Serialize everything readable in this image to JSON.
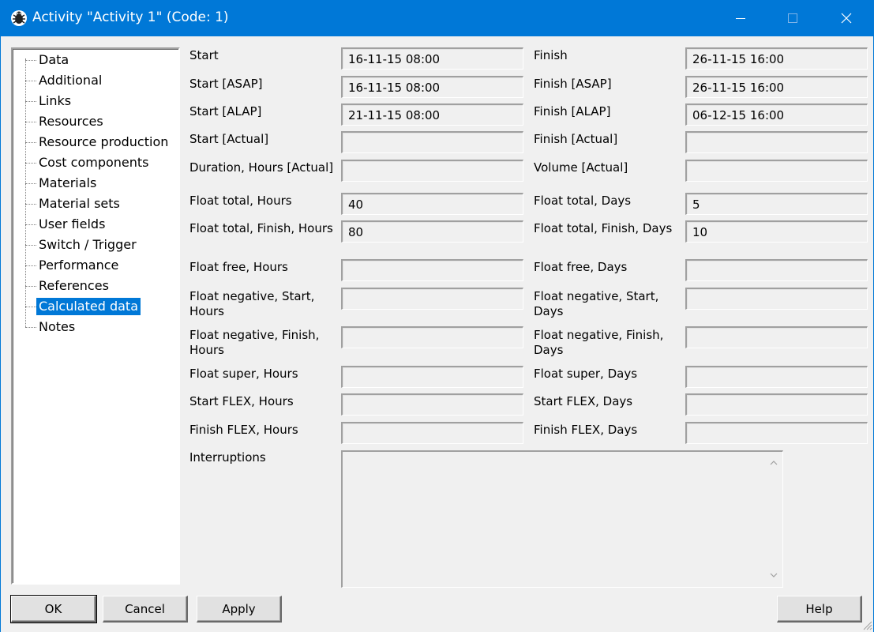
{
  "window": {
    "title": "Activity \"Activity 1\" (Code: 1)",
    "icon": "bug-app-icon",
    "title_bar_color": "#0078d7"
  },
  "tree": {
    "items": [
      {
        "label": "Data",
        "selected": false
      },
      {
        "label": "Additional",
        "selected": false
      },
      {
        "label": "Links",
        "selected": false
      },
      {
        "label": "Resources",
        "selected": false
      },
      {
        "label": "Resource production",
        "selected": false
      },
      {
        "label": "Cost components",
        "selected": false
      },
      {
        "label": "Materials",
        "selected": false
      },
      {
        "label": "Material sets",
        "selected": false
      },
      {
        "label": "User fields",
        "selected": false
      },
      {
        "label": "Switch / Trigger",
        "selected": false
      },
      {
        "label": "Performance",
        "selected": false
      },
      {
        "label": "References",
        "selected": false
      },
      {
        "label": "Calculated data",
        "selected": true
      },
      {
        "label": "Notes",
        "selected": false
      }
    ]
  },
  "form": {
    "rows": [
      {
        "left_label": "Start",
        "left_value": "16-11-15  08:00",
        "right_label": "Finish",
        "right_value": "26-11-15  16:00"
      },
      {
        "left_label": "Start [ASAP]",
        "left_value": "16-11-15  08:00",
        "right_label": "Finish [ASAP]",
        "right_value": "26-11-15  16:00"
      },
      {
        "left_label": "Start [ALAP]",
        "left_value": "21-11-15  08:00",
        "right_label": "Finish [ALAP]",
        "right_value": "06-12-15  16:00"
      },
      {
        "left_label": "Start [Actual]",
        "left_value": "",
        "right_label": "Finish [Actual]",
        "right_value": ""
      },
      {
        "left_label": "Duration, Hours [Actual]",
        "left_value": "",
        "right_label": "Volume [Actual]",
        "right_value": ""
      },
      {
        "left_label": "Float total, Hours",
        "left_value": "40",
        "right_label": "Float total, Days",
        "right_value": "5"
      },
      {
        "left_label": "Float total, Finish, Hours",
        "left_value": "80",
        "right_label": "Float total, Finish, Days",
        "right_value": "10"
      },
      {
        "left_label": "Float free, Hours",
        "left_value": "",
        "right_label": "Float free, Days",
        "right_value": ""
      },
      {
        "left_label": "Float negative, Start,",
        "left_label2": "Hours",
        "left_value": "",
        "right_label": "Float negative, Start,",
        "right_label2": "Days",
        "right_value": ""
      },
      {
        "left_label": "Float negative, Finish,",
        "left_label2": "Hours",
        "left_value": "",
        "right_label": "Float negative, Finish,",
        "right_label2": "Days",
        "right_value": ""
      },
      {
        "left_label": "Float super, Hours",
        "left_value": "",
        "right_label": "Float super, Days",
        "right_value": ""
      },
      {
        "left_label": "Start FLEX, Hours",
        "left_value": "",
        "right_label": "Start FLEX, Days",
        "right_value": ""
      },
      {
        "left_label": "Finish FLEX, Hours",
        "left_value": "",
        "right_label": "Finish FLEX, Days",
        "right_value": ""
      }
    ],
    "interruptions_label": "Interruptions",
    "interruptions_value": ""
  },
  "buttons": {
    "ok": "OK",
    "cancel": "Cancel",
    "apply": "Apply",
    "help": "Help"
  }
}
